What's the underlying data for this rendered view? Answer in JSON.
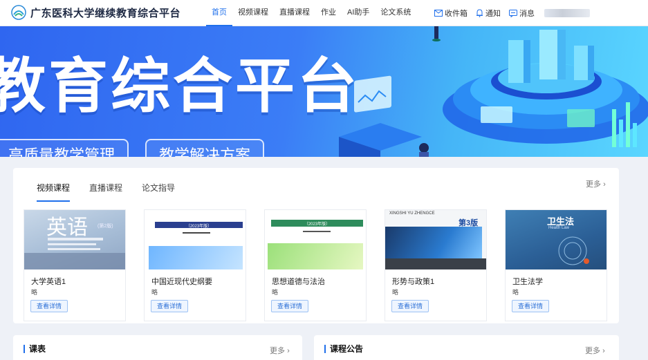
{
  "header": {
    "title": "广东医科大学继续教育综合平台",
    "nav": [
      {
        "label": "首页",
        "active": true
      },
      {
        "label": "视频课程",
        "active": false
      },
      {
        "label": "直播课程",
        "active": false
      },
      {
        "label": "作业",
        "active": false
      },
      {
        "label": "AI助手",
        "active": false
      },
      {
        "label": "论文系统",
        "active": false
      }
    ],
    "tools": {
      "inbox": "收件箱",
      "notify": "通知",
      "message": "消息"
    },
    "accent": "#1f6feb"
  },
  "banner": {
    "title": "教育综合平台",
    "pills": [
      "高质量教学管理",
      "教学解决方案"
    ]
  },
  "courses": {
    "tabs": [
      {
        "label": "视频课程",
        "active": true
      },
      {
        "label": "直播课程",
        "active": false
      },
      {
        "label": "论文指导",
        "active": false
      }
    ],
    "more": "更多",
    "items": [
      {
        "title": "大学英语1",
        "sub": "略",
        "button": "查看详情",
        "cover_text": "英语",
        "cover_edition": "(第2版)"
      },
      {
        "title": "中国近现代史纲要",
        "sub": "略",
        "button": "查看详情",
        "cover_text": "（2023年版）"
      },
      {
        "title": "思想道德与法治",
        "sub": "略",
        "button": "查看详情",
        "cover_text": "（2023年版）"
      },
      {
        "title": "形势与政策1",
        "sub": "略",
        "button": "查看详情",
        "cover_text": "XINGSHI YU ZHENGCE",
        "cover_edition": "第3版"
      },
      {
        "title": "卫生法学",
        "sub": "略",
        "button": "查看详情",
        "cover_text": "卫生法",
        "cover_edition": "Health Law"
      }
    ]
  },
  "schedule": {
    "title": "课表",
    "more": "更多"
  },
  "notice": {
    "title": "课程公告",
    "more": "更多"
  }
}
